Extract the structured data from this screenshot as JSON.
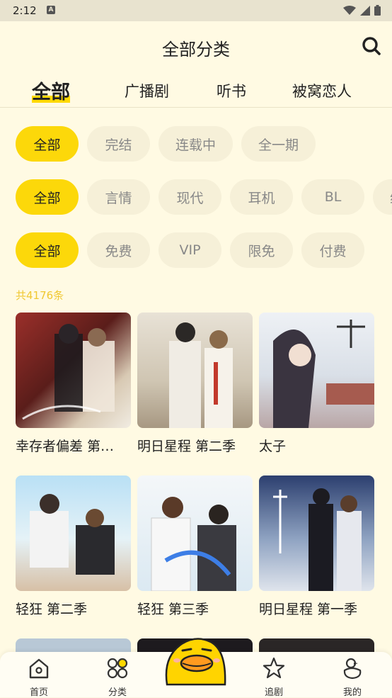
{
  "status_bar": {
    "time": "2:12",
    "badge": "A"
  },
  "header": {
    "title": "全部分类"
  },
  "tabs": [
    {
      "label": "全部",
      "active": true
    },
    {
      "label": "广播剧",
      "active": false
    },
    {
      "label": "听书",
      "active": false
    },
    {
      "label": "被窝恋人",
      "active": false
    }
  ],
  "filters": {
    "status": [
      "全部",
      "完结",
      "连载中",
      "全一期"
    ],
    "genre": [
      "全部",
      "言情",
      "现代",
      "耳机",
      "BL",
      "纯"
    ],
    "price": [
      "全部",
      "免费",
      "VIP",
      "限免",
      "付费"
    ]
  },
  "total_count": "共4176条",
  "items": [
    {
      "title": "幸存者偏差 第…",
      "cover_colors": [
        "#7a2a2a",
        "#c9b7a0"
      ]
    },
    {
      "title": "明日星程 第二季",
      "cover_colors": [
        "#d9d2c2",
        "#8a7f70"
      ]
    },
    {
      "title": "太子",
      "cover_colors": [
        "#dfe6ee",
        "#6a6470"
      ]
    },
    {
      "title": "轻狂 第二季",
      "cover_colors": [
        "#bfe0f2",
        "#e6cdb5"
      ]
    },
    {
      "title": "轻狂 第三季",
      "cover_colors": [
        "#e8f0f5",
        "#5a8fd0"
      ]
    },
    {
      "title": "明日星程 第一季",
      "cover_colors": [
        "#2a3e70",
        "#a9b8cf"
      ]
    }
  ],
  "bottom_nav": [
    {
      "label": "首页",
      "icon": "home-icon"
    },
    {
      "label": "分类",
      "icon": "category-icon"
    },
    {
      "label": "追剧",
      "icon": "star-icon"
    },
    {
      "label": "我的",
      "icon": "duck-profile-icon"
    }
  ],
  "colors": {
    "accent": "#fcd80a",
    "background": "#fffae3",
    "chip": "#f6f0d8"
  }
}
